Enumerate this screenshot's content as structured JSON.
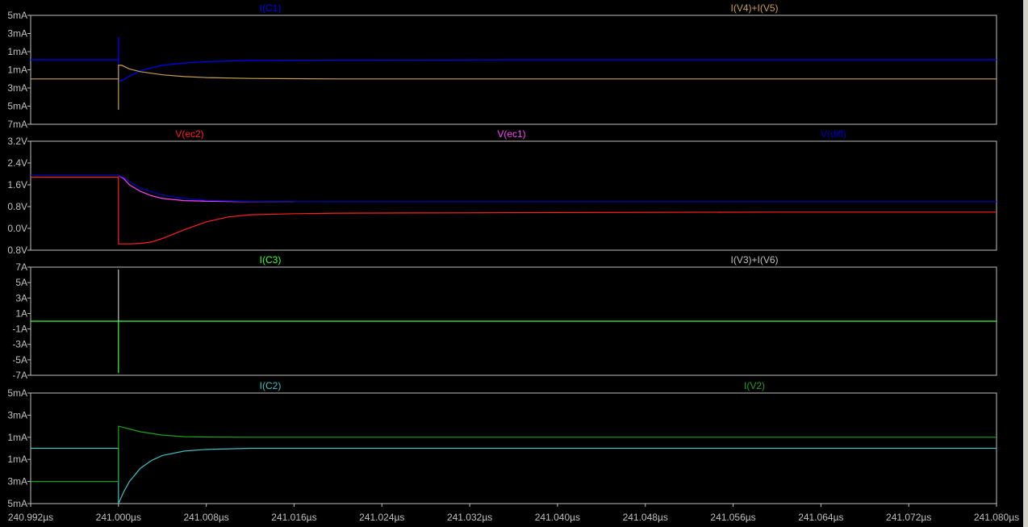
{
  "colors": {
    "background": "#000000",
    "frame": "#c0c0c0",
    "text": "#c0c0c0"
  },
  "chart_data": {
    "type": "line",
    "x_axis": {
      "unit": "µs",
      "range": [
        240.992,
        241.08
      ],
      "tick_labels": [
        "240.992µs",
        "241.000µs",
        "241.008µs",
        "241.016µs",
        "241.024µs",
        "241.032µs",
        "241.040µs",
        "241.048µs",
        "241.056µs",
        "241.064µs",
        "241.072µs",
        "241.080µs"
      ],
      "ticks": [
        240.992,
        241.0,
        241.008,
        241.016,
        241.024,
        241.032,
        241.04,
        241.048,
        241.056,
        241.064,
        241.072,
        241.08
      ]
    },
    "panes": [
      {
        "id": "pane1",
        "ylim": [
          -7,
          5
        ],
        "y_ticks": [
          5,
          3,
          1,
          -1,
          -3,
          -5,
          -7
        ],
        "y_tick_labels": [
          "5mA",
          "3mA",
          "1mA",
          "1mA",
          "3mA",
          "5mA",
          "7mA"
        ],
        "series": [
          {
            "name": "I(C1)",
            "color": "#0000ff",
            "x": [
              240.992,
              241.0,
              241.0,
              241.0,
              241.0003,
              241.001,
              241.002,
              241.004,
              241.006,
              241.008,
              241.012,
              241.02,
              241.04,
              241.08
            ],
            "y": [
              0.1,
              0.1,
              2.6,
              -2.2,
              -2.2,
              -1.7,
              -1.1,
              -0.5,
              -0.25,
              -0.1,
              0.03,
              0.08,
              0.1,
              0.1
            ]
          },
          {
            "name": "I(V4)+I(V5)",
            "color": "#c8a050",
            "x": [
              240.992,
              241.0,
              241.0,
              241.0,
              241.0003,
              241.001,
              241.002,
              241.004,
              241.006,
              241.008,
              241.012,
              241.02,
              241.04,
              241.08
            ],
            "y": [
              -2.0,
              -2.0,
              -5.4,
              -0.5,
              -0.5,
              -0.9,
              -1.2,
              -1.55,
              -1.75,
              -1.85,
              -1.95,
              -2.0,
              -2.0,
              -2.0
            ]
          }
        ]
      },
      {
        "id": "pane2",
        "ylim": [
          -0.8,
          3.2
        ],
        "y_ticks": [
          3.2,
          2.4,
          1.6,
          0.8,
          0.0,
          -0.8
        ],
        "y_tick_labels": [
          "3.2V",
          "2.4V",
          "1.6V",
          "0.8V",
          "0.0V",
          "0.8V"
        ],
        "series": [
          {
            "name": "V(ec2)",
            "color": "#ff2020",
            "x": [
              240.992,
              241.0,
              241.0,
              241.001,
              241.002,
              241.003,
              241.004,
              241.006,
              241.008,
              241.01,
              241.012,
              241.016,
              241.02,
              241.03,
              241.04,
              241.06,
              241.08
            ],
            "y": [
              1.88,
              1.88,
              -0.57,
              -0.57,
              -0.55,
              -0.5,
              -0.37,
              -0.05,
              0.24,
              0.42,
              0.5,
              0.54,
              0.56,
              0.57,
              0.58,
              0.6,
              0.6
            ]
          },
          {
            "name": "V(ec1)",
            "color": "#ff40ff",
            "x": [
              241.0,
              241.0005,
              241.001,
              241.002,
              241.003,
              241.004,
              241.006,
              241.008,
              241.01,
              241.012,
              241.016
            ],
            "y": [
              1.95,
              1.82,
              1.6,
              1.36,
              1.2,
              1.1,
              1.02,
              1.0,
              0.99,
              0.98,
              0.98
            ]
          },
          {
            "name": "V(diff)",
            "color": "#0000c0",
            "x": [
              240.992,
              241.0,
              241.0005,
              241.001,
              241.002,
              241.004,
              241.006,
              241.008,
              241.012,
              241.02,
              241.04,
              241.08
            ],
            "y": [
              1.96,
              1.96,
              1.86,
              1.72,
              1.48,
              1.22,
              1.1,
              1.03,
              0.99,
              0.98,
              0.98,
              0.98
            ]
          }
        ]
      },
      {
        "id": "pane3",
        "ylim": [
          -7,
          7
        ],
        "y_ticks": [
          7,
          5,
          3,
          1,
          -1,
          -3,
          -5,
          -7
        ],
        "y_tick_labels": [
          "7A",
          "5A",
          "3A",
          "1A",
          "-1A",
          "-3A",
          "-5A",
          "-7A"
        ],
        "series": [
          {
            "name": "I(C3)",
            "color": "#40ff40",
            "x": [
              240.992,
              241.0,
              241.0,
              241.0,
              241.08
            ],
            "y": [
              0.0,
              0.0,
              -6.7,
              0.0,
              0.0
            ]
          },
          {
            "name": "I(V3)+I(V6)",
            "color": "#c0c0c0",
            "x": [
              241.0,
              241.0,
              241.0
            ],
            "y": [
              0.0,
              6.7,
              0.0
            ]
          }
        ]
      },
      {
        "id": "pane4",
        "ylim": [
          -5,
          5
        ],
        "y_ticks": [
          5,
          3,
          1,
          -1,
          -3,
          -5
        ],
        "y_tick_labels": [
          "5mA",
          "3mA",
          "1mA",
          "1mA",
          "3mA",
          "5mA"
        ],
        "series": [
          {
            "name": "I(C2)",
            "color": "#40c0c0",
            "x": [
              240.992,
              241.0,
              241.0,
              241.0005,
              241.001,
              241.002,
              241.003,
              241.004,
              241.006,
              241.008,
              241.012,
              241.02,
              241.08
            ],
            "y": [
              0.0,
              0.0,
              -5.0,
              -3.9,
              -3.0,
              -1.8,
              -1.1,
              -0.65,
              -0.25,
              -0.1,
              0.0,
              0.0,
              0.0
            ]
          },
          {
            "name": "I(V2)",
            "color": "#20a020",
            "x": [
              240.992,
              241.0,
              241.0,
              241.001,
              241.002,
              241.004,
              241.006,
              241.008,
              241.012,
              241.02,
              241.08
            ],
            "y": [
              -3.0,
              -3.0,
              2.0,
              1.75,
              1.5,
              1.2,
              1.05,
              1.02,
              1.0,
              1.0,
              1.0
            ]
          }
        ]
      }
    ]
  }
}
